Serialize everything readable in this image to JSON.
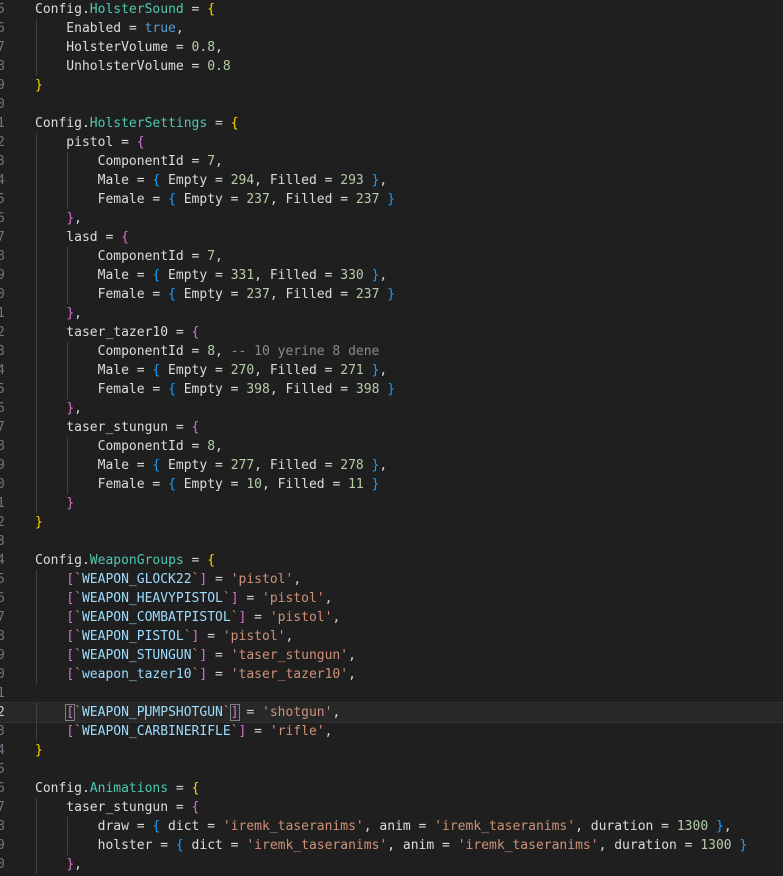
{
  "editor": {
    "colors": {
      "background": "#1f1f1f",
      "current_line": "#282828",
      "line_number": "#6e7681",
      "identifier": "#dcdcdc",
      "field": "#4ec9b0",
      "number": "#b5cea8",
      "keyword": "#569cd6",
      "string": "#ce9178",
      "comment": "#8b8b8b",
      "bracket_level_1": "#ffd700",
      "bracket_level_2": "#da70d6",
      "bracket_level_3": "#179fff",
      "key": "#9cdcfe"
    },
    "current_line_number": "2",
    "lines": [
      {
        "n": "5",
        "tokens": [
          [
            "id",
            "Config."
          ],
          [
            "prop",
            "HolsterSound"
          ],
          [
            "op",
            " = "
          ],
          [
            "b1",
            "{"
          ]
        ]
      },
      {
        "n": "6",
        "tokens": [
          [
            "id",
            "    Enabled = "
          ],
          [
            "kw",
            "true"
          ],
          [
            "op",
            ","
          ]
        ]
      },
      {
        "n": "7",
        "tokens": [
          [
            "id",
            "    HolsterVolume = "
          ],
          [
            "num",
            "0.8"
          ],
          [
            "op",
            ","
          ]
        ]
      },
      {
        "n": "8",
        "tokens": [
          [
            "id",
            "    UnholsterVolume = "
          ],
          [
            "num",
            "0.8"
          ]
        ]
      },
      {
        "n": "9",
        "tokens": [
          [
            "b1",
            "}"
          ]
        ]
      },
      {
        "n": "0",
        "tokens": []
      },
      {
        "n": "1",
        "tokens": [
          [
            "id",
            "Config."
          ],
          [
            "prop",
            "HolsterSettings"
          ],
          [
            "op",
            " = "
          ],
          [
            "b1",
            "{"
          ]
        ]
      },
      {
        "n": "2",
        "tokens": [
          [
            "id",
            "    pistol = "
          ],
          [
            "b2",
            "{"
          ]
        ]
      },
      {
        "n": "3",
        "tokens": [
          [
            "id",
            "        ComponentId = "
          ],
          [
            "num",
            "7"
          ],
          [
            "op",
            ","
          ]
        ]
      },
      {
        "n": "4",
        "tokens": [
          [
            "id",
            "        Male = "
          ],
          [
            "b3",
            "{"
          ],
          [
            "id",
            " Empty = "
          ],
          [
            "num",
            "294"
          ],
          [
            "id",
            ", Filled = "
          ],
          [
            "num",
            "293"
          ],
          [
            "op",
            " "
          ],
          [
            "b3",
            "}"
          ],
          [
            "op",
            ","
          ]
        ]
      },
      {
        "n": "5",
        "tokens": [
          [
            "id",
            "        Female = "
          ],
          [
            "b3",
            "{"
          ],
          [
            "id",
            " Empty = "
          ],
          [
            "num",
            "237"
          ],
          [
            "id",
            ", Filled = "
          ],
          [
            "num",
            "237"
          ],
          [
            "op",
            " "
          ],
          [
            "b3",
            "}"
          ]
        ]
      },
      {
        "n": "6",
        "tokens": [
          [
            "op",
            "    "
          ],
          [
            "b2",
            "}"
          ],
          [
            "op",
            ","
          ]
        ]
      },
      {
        "n": "7",
        "tokens": [
          [
            "id",
            "    lasd = "
          ],
          [
            "b2",
            "{"
          ]
        ]
      },
      {
        "n": "8",
        "tokens": [
          [
            "id",
            "        ComponentId = "
          ],
          [
            "num",
            "7"
          ],
          [
            "op",
            ","
          ]
        ]
      },
      {
        "n": "9",
        "tokens": [
          [
            "id",
            "        Male = "
          ],
          [
            "b3",
            "{"
          ],
          [
            "id",
            " Empty = "
          ],
          [
            "num",
            "331"
          ],
          [
            "id",
            ", Filled = "
          ],
          [
            "num",
            "330"
          ],
          [
            "op",
            " "
          ],
          [
            "b3",
            "}"
          ],
          [
            "op",
            ","
          ]
        ]
      },
      {
        "n": "0",
        "tokens": [
          [
            "id",
            "        Female = "
          ],
          [
            "b3",
            "{"
          ],
          [
            "id",
            " Empty = "
          ],
          [
            "num",
            "237"
          ],
          [
            "id",
            ", Filled = "
          ],
          [
            "num",
            "237"
          ],
          [
            "op",
            " "
          ],
          [
            "b3",
            "}"
          ]
        ]
      },
      {
        "n": "1",
        "tokens": [
          [
            "op",
            "    "
          ],
          [
            "b2",
            "}"
          ],
          [
            "op",
            ","
          ]
        ]
      },
      {
        "n": "2",
        "tokens": [
          [
            "id",
            "    taser_tazer10 = "
          ],
          [
            "b2",
            "{"
          ]
        ]
      },
      {
        "n": "3",
        "tokens": [
          [
            "id",
            "        ComponentId = "
          ],
          [
            "num",
            "8"
          ],
          [
            "op",
            ", "
          ],
          [
            "cmt",
            "-- 10 yerine 8 dene"
          ]
        ]
      },
      {
        "n": "4",
        "tokens": [
          [
            "id",
            "        Male = "
          ],
          [
            "b3",
            "{"
          ],
          [
            "id",
            " Empty = "
          ],
          [
            "num",
            "270"
          ],
          [
            "id",
            ", Filled = "
          ],
          [
            "num",
            "271"
          ],
          [
            "op",
            " "
          ],
          [
            "b3",
            "}"
          ],
          [
            "op",
            ","
          ]
        ]
      },
      {
        "n": "5",
        "tokens": [
          [
            "id",
            "        Female = "
          ],
          [
            "b3",
            "{"
          ],
          [
            "id",
            " Empty = "
          ],
          [
            "num",
            "398"
          ],
          [
            "id",
            ", Filled = "
          ],
          [
            "num",
            "398"
          ],
          [
            "op",
            " "
          ],
          [
            "b3",
            "}"
          ]
        ]
      },
      {
        "n": "6",
        "tokens": [
          [
            "op",
            "    "
          ],
          [
            "b2",
            "}"
          ],
          [
            "op",
            ","
          ]
        ]
      },
      {
        "n": "7",
        "tokens": [
          [
            "id",
            "    taser_stungun = "
          ],
          [
            "b2",
            "{"
          ]
        ]
      },
      {
        "n": "8",
        "tokens": [
          [
            "id",
            "        ComponentId = "
          ],
          [
            "num",
            "8"
          ],
          [
            "op",
            ","
          ]
        ]
      },
      {
        "n": "9",
        "tokens": [
          [
            "id",
            "        Male = "
          ],
          [
            "b3",
            "{"
          ],
          [
            "id",
            " Empty = "
          ],
          [
            "num",
            "277"
          ],
          [
            "id",
            ", Filled = "
          ],
          [
            "num",
            "278"
          ],
          [
            "op",
            " "
          ],
          [
            "b3",
            "}"
          ],
          [
            "op",
            ","
          ]
        ]
      },
      {
        "n": "0",
        "tokens": [
          [
            "id",
            "        Female = "
          ],
          [
            "b3",
            "{"
          ],
          [
            "id",
            " Empty = "
          ],
          [
            "num",
            "10"
          ],
          [
            "id",
            ", Filled = "
          ],
          [
            "num",
            "11"
          ],
          [
            "op",
            " "
          ],
          [
            "b3",
            "}"
          ]
        ]
      },
      {
        "n": "1",
        "tokens": [
          [
            "op",
            "    "
          ],
          [
            "b2",
            "}"
          ]
        ]
      },
      {
        "n": "2",
        "tokens": [
          [
            "b1",
            "}"
          ]
        ]
      },
      {
        "n": "3",
        "tokens": []
      },
      {
        "n": "4",
        "tokens": [
          [
            "id",
            "Config."
          ],
          [
            "prop",
            "WeaponGroups"
          ],
          [
            "op",
            " = "
          ],
          [
            "b1",
            "{"
          ]
        ]
      },
      {
        "n": "5",
        "tokens": [
          [
            "op",
            "    "
          ],
          [
            "b2",
            "["
          ],
          [
            "str",
            "`"
          ],
          [
            "key",
            "WEAPON_GLOCK22"
          ],
          [
            "str",
            "`"
          ],
          [
            "b2",
            "]"
          ],
          [
            "op",
            " = "
          ],
          [
            "str",
            "'pistol'"
          ],
          [
            "op",
            ","
          ]
        ]
      },
      {
        "n": "6",
        "tokens": [
          [
            "op",
            "    "
          ],
          [
            "b2",
            "["
          ],
          [
            "str",
            "`"
          ],
          [
            "key",
            "WEAPON_HEAVYPISTOL"
          ],
          [
            "str",
            "`"
          ],
          [
            "b2",
            "]"
          ],
          [
            "op",
            " = "
          ],
          [
            "str",
            "'pistol'"
          ],
          [
            "op",
            ","
          ]
        ]
      },
      {
        "n": "7",
        "tokens": [
          [
            "op",
            "    "
          ],
          [
            "b2",
            "["
          ],
          [
            "str",
            "`"
          ],
          [
            "key",
            "WEAPON_COMBATPISTOL"
          ],
          [
            "str",
            "`"
          ],
          [
            "b2",
            "]"
          ],
          [
            "op",
            " = "
          ],
          [
            "str",
            "'pistol'"
          ],
          [
            "op",
            ","
          ]
        ]
      },
      {
        "n": "8",
        "tokens": [
          [
            "op",
            "    "
          ],
          [
            "b2",
            "["
          ],
          [
            "str",
            "`"
          ],
          [
            "key",
            "WEAPON_PISTOL"
          ],
          [
            "str",
            "`"
          ],
          [
            "b2",
            "]"
          ],
          [
            "op",
            " = "
          ],
          [
            "str",
            "'pistol'"
          ],
          [
            "op",
            ","
          ]
        ]
      },
      {
        "n": "9",
        "tokens": [
          [
            "op",
            "    "
          ],
          [
            "b2",
            "["
          ],
          [
            "str",
            "`"
          ],
          [
            "key",
            "WEAPON_STUNGUN"
          ],
          [
            "str",
            "`"
          ],
          [
            "b2",
            "]"
          ],
          [
            "op",
            " = "
          ],
          [
            "str",
            "'taser_stungun'"
          ],
          [
            "op",
            ","
          ]
        ]
      },
      {
        "n": "0",
        "tokens": [
          [
            "op",
            "    "
          ],
          [
            "b2",
            "["
          ],
          [
            "str",
            "`"
          ],
          [
            "key",
            "weapon_tazer10"
          ],
          [
            "str",
            "`"
          ],
          [
            "b2",
            "]"
          ],
          [
            "op",
            " = "
          ],
          [
            "str",
            "'taser_tazer10'"
          ],
          [
            "op",
            ","
          ]
        ]
      },
      {
        "n": "1",
        "tokens": []
      },
      {
        "n": "2",
        "current": true,
        "tokens": [
          [
            "op",
            "    "
          ],
          [
            "b2m",
            "["
          ],
          [
            "str",
            "`"
          ],
          [
            "key",
            "WEAPON_P"
          ],
          [
            "cursor",
            ""
          ],
          [
            "key",
            "UMPSHOTGUN"
          ],
          [
            "str",
            "`"
          ],
          [
            "b2m",
            "]"
          ],
          [
            "op",
            " = "
          ],
          [
            "str",
            "'shotgun'"
          ],
          [
            "op",
            ","
          ]
        ]
      },
      {
        "n": "3",
        "tokens": [
          [
            "op",
            "    "
          ],
          [
            "b2",
            "["
          ],
          [
            "str",
            "`"
          ],
          [
            "key",
            "WEAPON_CARBINERIFLE"
          ],
          [
            "str",
            "`"
          ],
          [
            "b2",
            "]"
          ],
          [
            "op",
            " = "
          ],
          [
            "str",
            "'rifle'"
          ],
          [
            "op",
            ","
          ]
        ]
      },
      {
        "n": "4",
        "tokens": [
          [
            "b1",
            "}"
          ]
        ]
      },
      {
        "n": "5",
        "tokens": []
      },
      {
        "n": "6",
        "tokens": [
          [
            "id",
            "Config."
          ],
          [
            "prop",
            "Animations"
          ],
          [
            "op",
            " = "
          ],
          [
            "b1",
            "{"
          ]
        ]
      },
      {
        "n": "7",
        "tokens": [
          [
            "id",
            "    taser_stungun = "
          ],
          [
            "b2",
            "{"
          ]
        ]
      },
      {
        "n": "8",
        "tokens": [
          [
            "id",
            "        draw = "
          ],
          [
            "b3",
            "{"
          ],
          [
            "id",
            " dict = "
          ],
          [
            "str",
            "'iremk_taseranims'"
          ],
          [
            "id",
            ", anim = "
          ],
          [
            "str",
            "'iremk_taseranims'"
          ],
          [
            "id",
            ", duration = "
          ],
          [
            "num",
            "1300"
          ],
          [
            "op",
            " "
          ],
          [
            "b3",
            "}"
          ],
          [
            "op",
            ","
          ]
        ]
      },
      {
        "n": "9",
        "tokens": [
          [
            "id",
            "        holster = "
          ],
          [
            "b3",
            "{"
          ],
          [
            "id",
            " dict = "
          ],
          [
            "str",
            "'iremk_taseranims'"
          ],
          [
            "id",
            ", anim = "
          ],
          [
            "str",
            "'iremk_taseranims'"
          ],
          [
            "id",
            ", duration = "
          ],
          [
            "num",
            "1300"
          ],
          [
            "op",
            " "
          ],
          [
            "b3",
            "}"
          ]
        ]
      },
      {
        "n": "0",
        "tokens": [
          [
            "op",
            "    "
          ],
          [
            "b2",
            "}"
          ],
          [
            "op",
            ","
          ]
        ]
      }
    ]
  }
}
